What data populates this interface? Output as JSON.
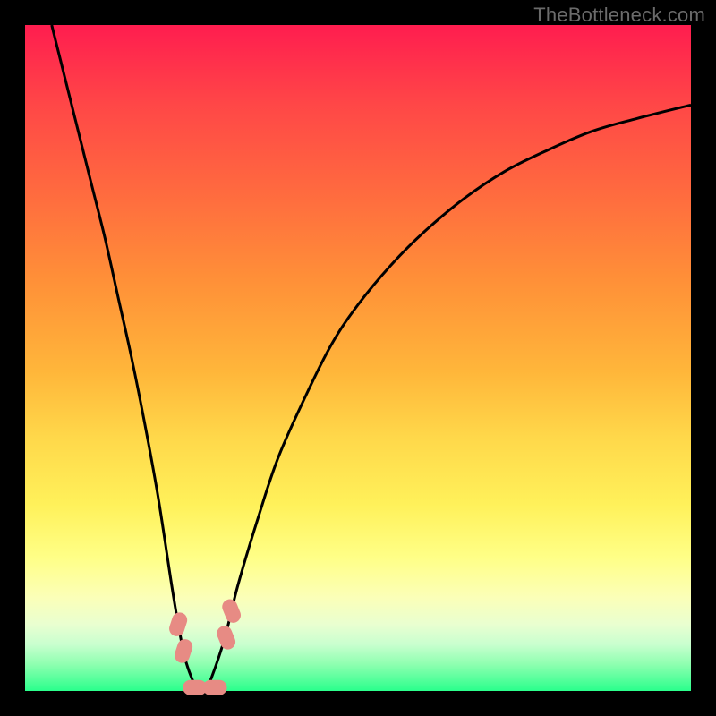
{
  "watermark": "TheBottleneck.com",
  "chart_data": {
    "type": "line",
    "title": "",
    "xlabel": "",
    "ylabel": "",
    "xlim": [
      0,
      100
    ],
    "ylim": [
      0,
      100
    ],
    "series": [
      {
        "name": "left-curve",
        "x": [
          4,
          6,
          8,
          10,
          12,
          14,
          16,
          18,
          20,
          22,
          23,
          24,
          25,
          26
        ],
        "y": [
          100,
          92,
          84,
          76,
          68,
          59,
          50,
          40,
          29,
          16,
          10,
          5,
          2,
          0
        ]
      },
      {
        "name": "right-curve",
        "x": [
          27,
          28,
          30,
          32,
          35,
          38,
          42,
          46,
          50,
          55,
          60,
          66,
          72,
          78,
          85,
          92,
          100
        ],
        "y": [
          0,
          2,
          8,
          16,
          26,
          35,
          44,
          52,
          58,
          64,
          69,
          74,
          78,
          81,
          84,
          86,
          88
        ]
      }
    ],
    "markers": [
      {
        "name": "bead-left-upper",
        "x": 23.0,
        "y": 10.0
      },
      {
        "name": "bead-left-lower",
        "x": 23.8,
        "y": 6.0
      },
      {
        "name": "bead-bottom-1",
        "x": 25.5,
        "y": 0.5
      },
      {
        "name": "bead-bottom-2",
        "x": 28.5,
        "y": 0.5
      },
      {
        "name": "bead-right-lower",
        "x": 30.2,
        "y": 8.0
      },
      {
        "name": "bead-right-upper",
        "x": 31.0,
        "y": 12.0
      }
    ],
    "background_gradient": {
      "top": "#ff1d4f",
      "mid": "#ffe85a",
      "bottom": "#2aff8c"
    }
  }
}
